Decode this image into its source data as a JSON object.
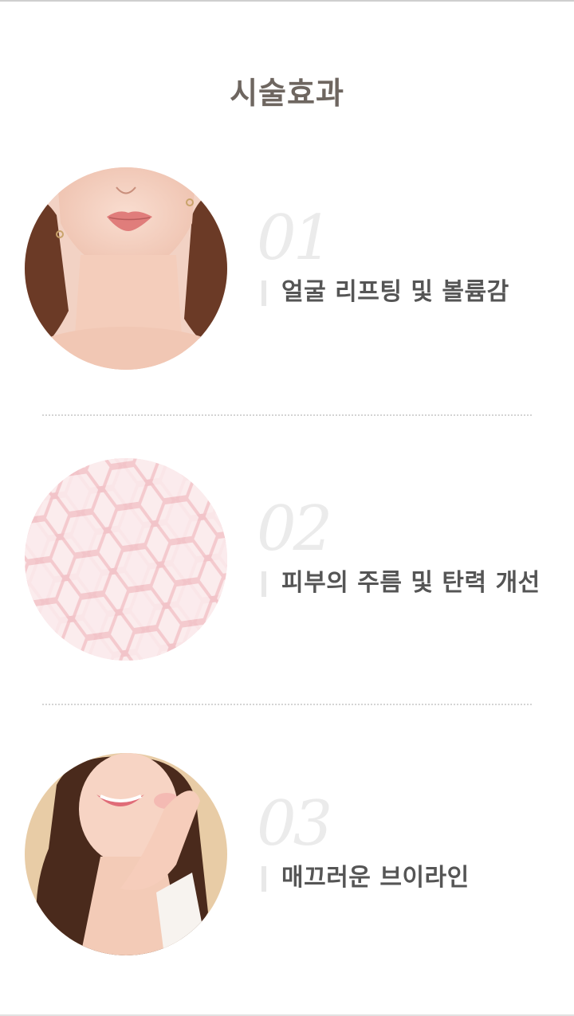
{
  "page": {
    "title": "시술효과"
  },
  "effects": [
    {
      "number": "01",
      "label": "얼굴 리프팅 및 볼륨감",
      "image": "woman-lips-neck-photo"
    },
    {
      "number": "02",
      "label": "피부의 주름 및 탄력 개선",
      "image": "pink-honeycomb-texture"
    },
    {
      "number": "03",
      "label": "매끄러운 브이라인",
      "image": "smiling-woman-hand-cheek-photo"
    }
  ],
  "colors": {
    "title": "#6e6660",
    "label": "#555555",
    "number": "#ebebeb",
    "divider": "#d4d4d4",
    "honeycomb": "#f4c9cd"
  }
}
